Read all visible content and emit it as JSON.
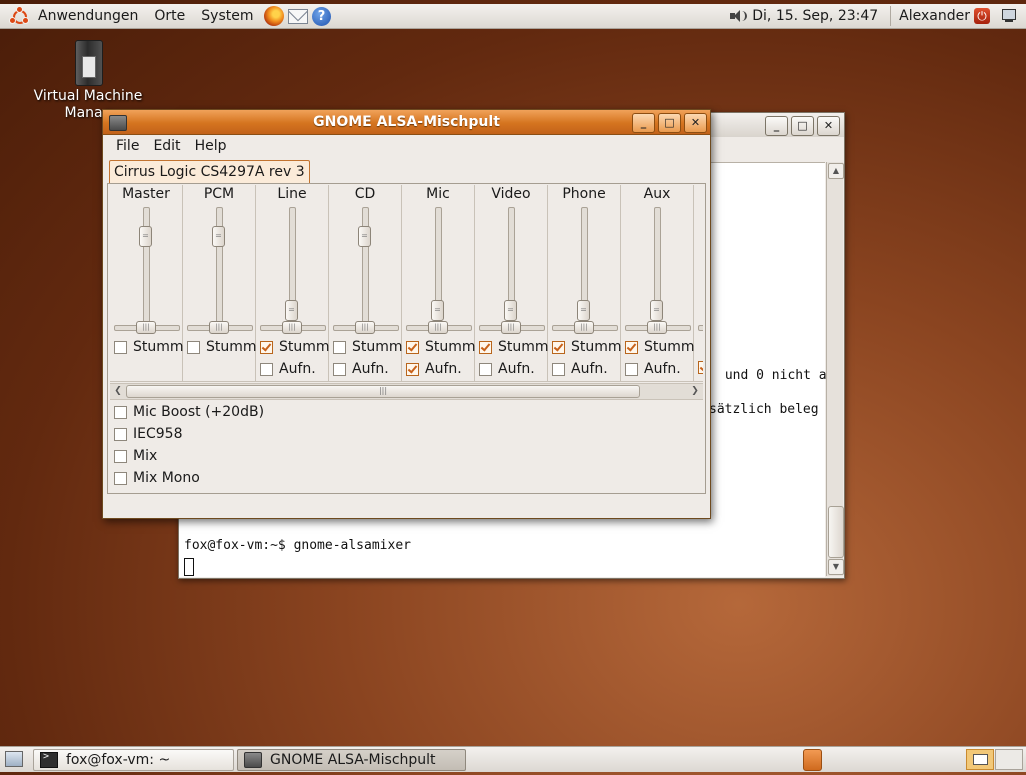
{
  "top_panel": {
    "menus": [
      "Anwendungen",
      "Orte",
      "System"
    ],
    "launchers": [
      "firefox-icon",
      "mail-icon",
      "help-icon"
    ],
    "clock": "Di, 15. Sep, 23:47",
    "user": "Alexander"
  },
  "desktop": {
    "icon_label_line1": "Virtual Machine",
    "icon_label_line2": "Manag"
  },
  "terminal": {
    "lines": [
      " und 0 nicht a",
      "sätzlich beleg",
      "fox@fox-vm:~$ gnome-alsamixer"
    ]
  },
  "mixer": {
    "title": "GNOME ALSA-Mischpult",
    "menus": [
      "File",
      "Edit",
      "Help"
    ],
    "tab": "Cirrus Logic CS4297A rev 3",
    "channels": [
      {
        "name": "Master",
        "level": 0.8,
        "mute_label": "Stumm",
        "muted": false
      },
      {
        "name": "PCM",
        "level": 0.8,
        "mute_label": "Stumm",
        "muted": false
      },
      {
        "name": "Line",
        "level": 0.04,
        "mute_label": "Stumm",
        "muted": true,
        "rec_label": "Aufn.",
        "rec": false
      },
      {
        "name": "CD",
        "level": 0.8,
        "mute_label": "Stumm",
        "muted": false,
        "rec_label": "Aufn.",
        "rec": false
      },
      {
        "name": "Mic",
        "level": 0.04,
        "mute_label": "Stumm",
        "muted": true,
        "rec_label": "Aufn.",
        "rec": true
      },
      {
        "name": "Video",
        "level": 0.04,
        "mute_label": "Stumm",
        "muted": true,
        "rec_label": "Aufn.",
        "rec": false
      },
      {
        "name": "Phone",
        "level": 0.04,
        "mute_label": "Stumm",
        "muted": true,
        "rec_label": "Aufn.",
        "rec": false
      },
      {
        "name": "Aux",
        "level": 0.04,
        "mute_label": "Stumm",
        "muted": true,
        "rec_label": "Aufn.",
        "rec": false
      }
    ],
    "options": [
      {
        "label": "Mic Boost (+20dB)",
        "checked": false
      },
      {
        "label": "IEC958",
        "checked": false
      },
      {
        "label": "Mix",
        "checked": false
      },
      {
        "label": "Mix Mono",
        "checked": false
      }
    ]
  },
  "taskbar": {
    "tasks": [
      "fox@fox-vm: ~",
      "GNOME ALSA-Mischpult"
    ]
  },
  "colors": {
    "accent": "#d5741f",
    "desktop": "#62290f",
    "check": "#c8621a"
  }
}
